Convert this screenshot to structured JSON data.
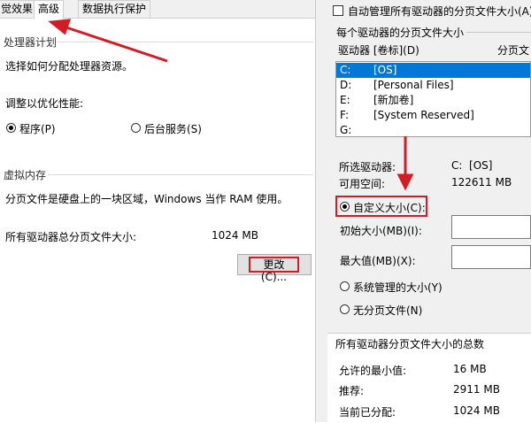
{
  "left": {
    "tabs": [
      {
        "label": "觉效果"
      },
      {
        "label": "高级"
      },
      {
        "label": "数据执行保护"
      }
    ],
    "processor": {
      "title": "处理器计划",
      "desc": "选择如何分配处理器资源。",
      "adjust_label": "调整以优化性能:",
      "opt_programs": "程序(P)",
      "opt_background": "后台服务(S)"
    },
    "vm": {
      "title": "虚拟内存",
      "desc": "分页文件是硬盘上的一块区域，Windows 当作 RAM 使用。",
      "total_label": "所有驱动器总分页文件大小:",
      "total_value": "1024 MB",
      "change_button": "更改(C)..."
    }
  },
  "right": {
    "auto_manage_label": "自动管理所有驱动器的分页文件大小(A)",
    "per_drive_title": "每个驱动器的分页文件大小",
    "col_drive": "驱动器 [卷标](D)",
    "col_size": "分页文",
    "drives": [
      {
        "letter": "C:",
        "label": "[OS]"
      },
      {
        "letter": "D:",
        "label": "[Personal Files]"
      },
      {
        "letter": "E:",
        "label": "[新加卷]"
      },
      {
        "letter": "F:",
        "label": "[System Reserved]"
      },
      {
        "letter": "G:",
        "label": ""
      }
    ],
    "selected_drive_label": "所选驱动器:",
    "selected_drive_value": "C:  [OS]",
    "free_space_label": "可用空间:",
    "free_space_value": "122611 MB",
    "custom_size": "自定义大小(C):",
    "initial_size_label": "初始大小(MB)(I):",
    "max_size_label": "最大值(MB)(X):",
    "system_managed": "系统管理的大小(Y)",
    "no_paging": "无分页文件(N)",
    "totals_title": "所有驱动器分页文件大小的总数",
    "min_allowed_label": "允许的最小值:",
    "min_allowed_value": "16 MB",
    "recommended_label": "推荐:",
    "recommended_value": "2911 MB",
    "current_label": "当前已分配:",
    "current_value": "1024 MB"
  },
  "colors": {
    "highlight": "#d41c24",
    "selection": "#0078d7"
  }
}
